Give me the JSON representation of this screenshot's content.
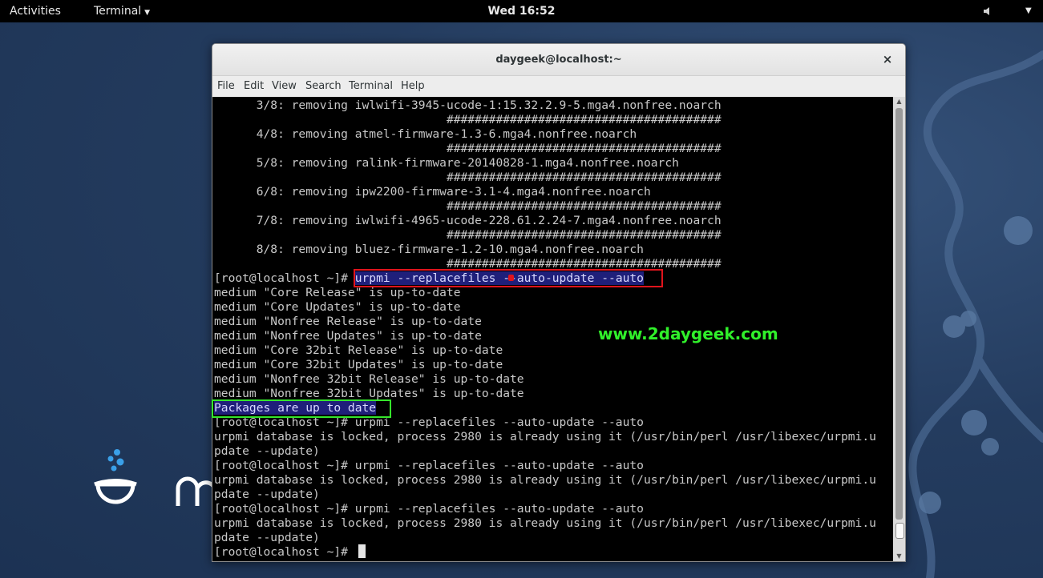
{
  "topbar": {
    "activities": "Activities",
    "app_menu": "Terminal",
    "clock": "Wed 16:52"
  },
  "icons": {
    "app_menu_arrow": "chevron-down-icon",
    "volume": "speaker-icon",
    "system_menu": "chevron-down-icon",
    "close": "close-icon"
  },
  "window": {
    "title": "daygeek@localhost:~",
    "close_glyph": "×",
    "menus": [
      "File",
      "Edit",
      "View",
      "Search",
      "Terminal",
      "Help"
    ]
  },
  "terminal": {
    "lines": [
      "      3/8: removing iwlwifi-3945-ucode-1:15.32.2.9-5.mga4.nonfree.noarch",
      "                                 #######################################",
      "      4/8: removing atmel-firmware-1.3-6.mga4.nonfree.noarch",
      "                                 #######################################",
      "      5/8: removing ralink-firmware-20140828-1.mga4.nonfree.noarch",
      "                                 #######################################",
      "      6/8: removing ipw2200-firmware-3.1-4.mga4.nonfree.noarch",
      "                                 #######################################",
      "      7/8: removing iwlwifi-4965-ucode-228.61.2.24-7.mga4.nonfree.noarch",
      "                                 #######################################",
      "      8/8: removing bluez-firmware-1.2-10.mga4.nonfree.noarch",
      "                                 #######################################",
      "[root@localhost ~]# urpmi --replacefiles --auto-update --auto",
      "medium \"Core Release\" is up-to-date",
      "medium \"Core Updates\" is up-to-date",
      "medium \"Nonfree Release\" is up-to-date",
      "medium \"Nonfree Updates\" is up-to-date",
      "medium \"Core 32bit Release\" is up-to-date",
      "medium \"Core 32bit Updates\" is up-to-date",
      "medium \"Nonfree 32bit Release\" is up-to-date",
      "medium \"Nonfree 32bit Updates\" is up-to-date",
      "Packages are up to date",
      "[root@localhost ~]# urpmi --replacefiles --auto-update --auto",
      "urpmi database is locked, process 2980 is already using it (/usr/bin/perl /usr/libexec/urpmi.u",
      "pdate --update)",
      "[root@localhost ~]# urpmi --replacefiles --auto-update --auto",
      "urpmi database is locked, process 2980 is already using it (/usr/bin/perl /usr/libexec/urpmi.u",
      "pdate --update)",
      "[root@localhost ~]# urpmi --replacefiles --auto-update --auto",
      "urpmi database is locked, process 2980 is already using it (/usr/bin/perl /usr/libexec/urpmi.u",
      "pdate --update)",
      "[root@localhost ~]# "
    ],
    "highlight_command": {
      "prompt": "[root@localhost ~]# ",
      "command": "urpmi --replacefiles --auto-update --auto"
    },
    "highlight_result": "Packages are up to date"
  },
  "watermark": "www.2daygeek.com",
  "colors": {
    "annotation_red": "#e0141c",
    "annotation_green": "#35e62b",
    "watermark": "#30f02a",
    "selection": "#1f1f7a"
  }
}
